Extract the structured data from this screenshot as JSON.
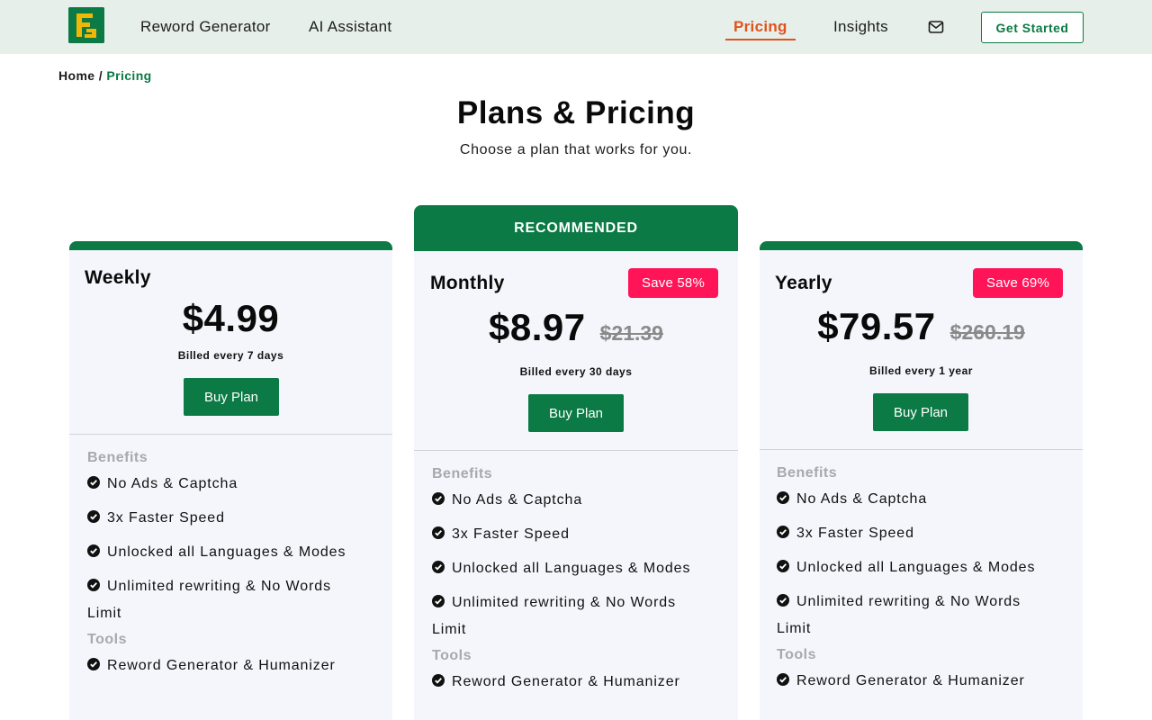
{
  "header": {
    "logo_icon": "brand-logo-icon",
    "nav": {
      "reword_generator": "Reword Generator",
      "ai_assistant": "AI Assistant",
      "pricing": "Pricing",
      "insights": "Insights"
    },
    "mail_icon": "envelope-icon",
    "get_started": "Get Started"
  },
  "breadcrumb": {
    "home": "Home",
    "separator": " / ",
    "current": "Pricing"
  },
  "page": {
    "title": "Plans & Pricing",
    "subtitle": "Choose a plan that works for you."
  },
  "plans": [
    {
      "name": "Weekly",
      "price": "$4.99",
      "billing": "Billed every 7 days",
      "buy_label": "Buy Plan",
      "benefits_heading": "Benefits",
      "benefits": [
        "No Ads & Captcha",
        "3x Faster Speed",
        "Unlocked all Languages & Modes",
        "Unlimited rewriting & No Words Limit"
      ],
      "tools_heading": "Tools",
      "tools": [
        "Reword Generator & Humanizer"
      ]
    },
    {
      "recommended": "RECOMMENDED",
      "name": "Monthly",
      "save": "Save 58%",
      "price": "$8.97",
      "old_price": "$21.39",
      "billing": "Billed every 30 days",
      "buy_label": "Buy Plan",
      "benefits_heading": "Benefits",
      "benefits": [
        "No Ads & Captcha",
        "3x Faster Speed",
        "Unlocked all Languages & Modes",
        "Unlimited rewriting & No Words Limit"
      ],
      "tools_heading": "Tools",
      "tools": [
        "Reword Generator & Humanizer"
      ]
    },
    {
      "name": "Yearly",
      "save": "Save 69%",
      "price": "$79.57",
      "old_price": "$260.19",
      "billing": "Billed every 1 year",
      "buy_label": "Buy Plan",
      "benefits_heading": "Benefits",
      "benefits": [
        "No Ads & Captcha",
        "3x Faster Speed",
        "Unlocked all Languages & Modes",
        "Unlimited rewriting & No Words Limit"
      ],
      "tools_heading": "Tools",
      "tools": [
        "Reword Generator & Humanizer"
      ]
    }
  ],
  "colors": {
    "brand_green": "#0b7a45",
    "header_bg": "#e6efe9",
    "active_nav": "#e0521e",
    "save_badge": "#ff1458",
    "card_bg": "#f4f6fc"
  }
}
